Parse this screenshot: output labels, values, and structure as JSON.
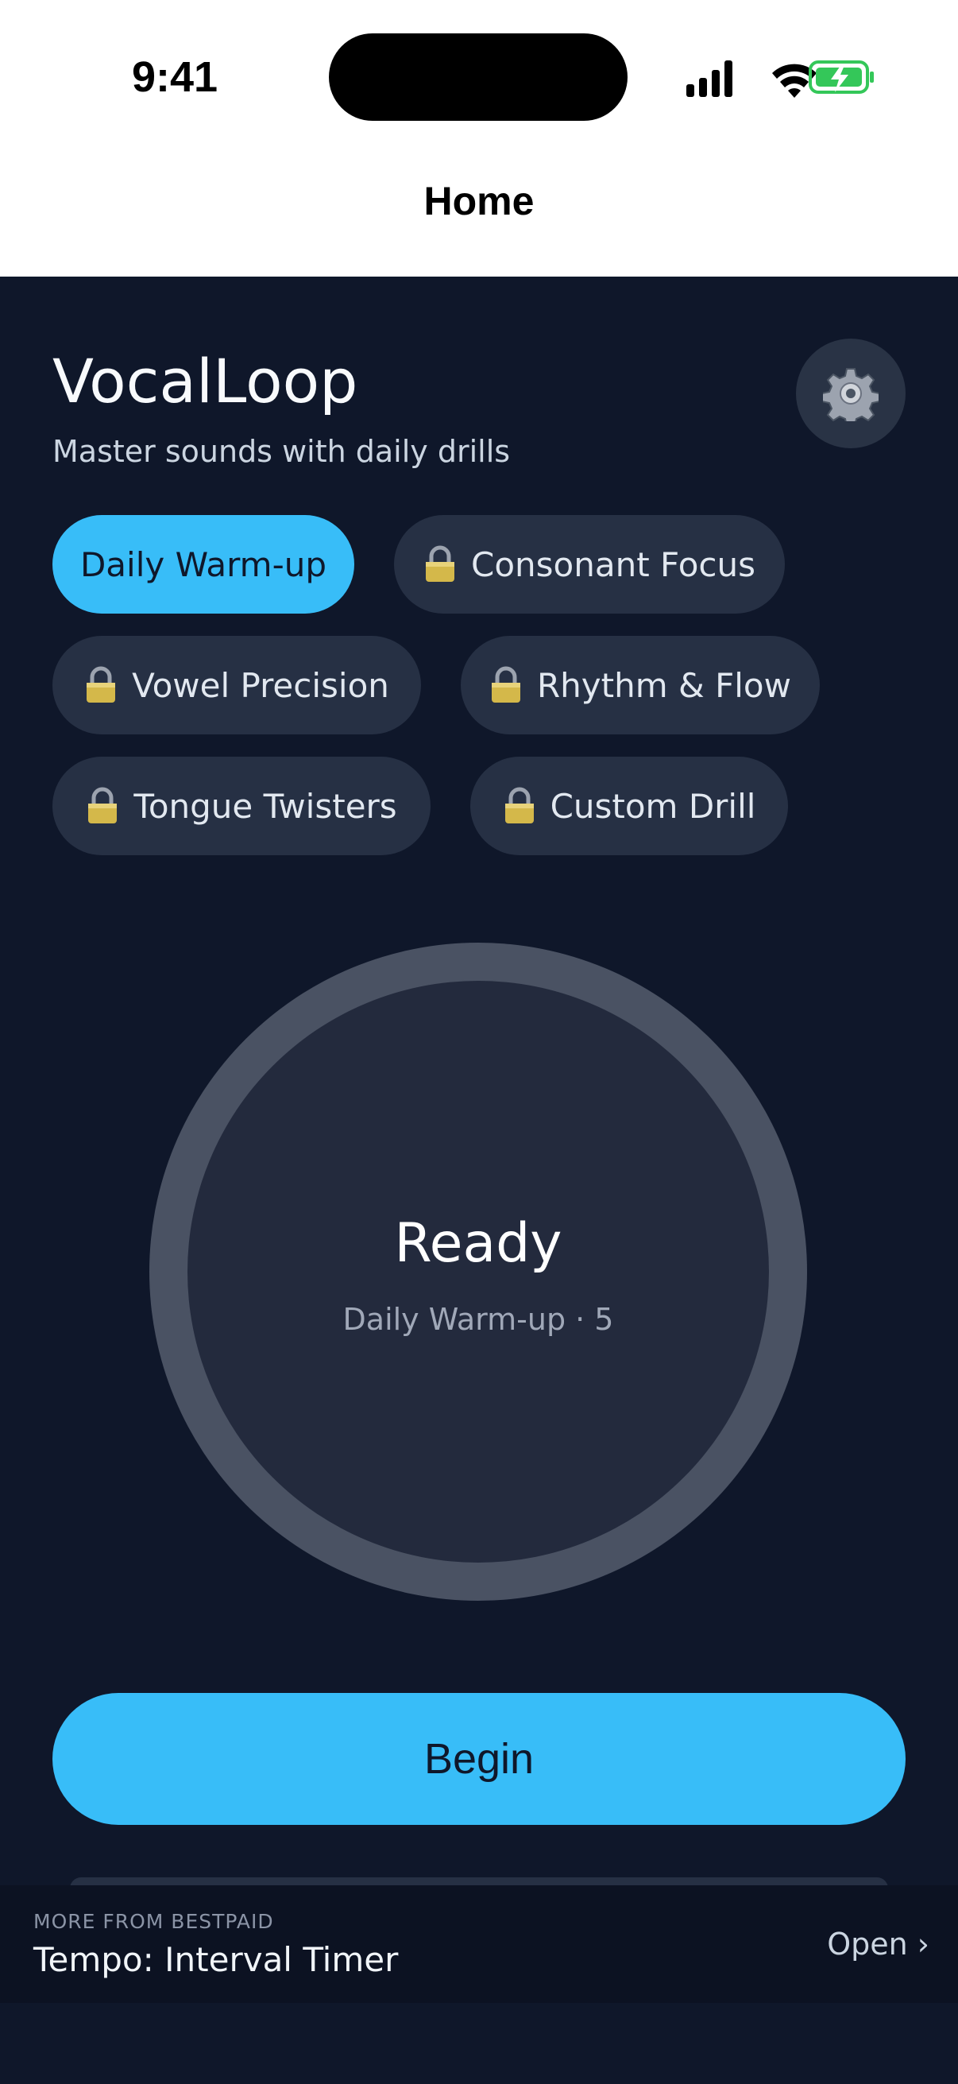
{
  "status_bar": {
    "time": "9:41",
    "icons": [
      "signal-icon",
      "wifi-icon",
      "battery-charging-icon"
    ],
    "battery_color": "#34c759"
  },
  "nav": {
    "title": "Home"
  },
  "header": {
    "title": "VocalLoop",
    "subtitle": "Master sounds with daily drills",
    "settings_icon": "gear-icon"
  },
  "drills": [
    {
      "label": "Daily Warm-up",
      "locked": false,
      "selected": true
    },
    {
      "label": "Consonant Focus",
      "locked": true,
      "selected": false
    },
    {
      "label": "Vowel Precision",
      "locked": true,
      "selected": false
    },
    {
      "label": "Rhythm & Flow",
      "locked": true,
      "selected": false
    },
    {
      "label": "Tongue Twisters",
      "locked": true,
      "selected": false
    },
    {
      "label": "Custom Drill",
      "locked": true,
      "selected": false
    }
  ],
  "dial": {
    "title": "Ready",
    "subtitle": "Daily Warm-up · 5"
  },
  "begin": {
    "label": "Begin"
  },
  "promo": {
    "eyebrow": "MORE FROM BESTPAID",
    "title": "Tempo: Interval Timer",
    "action": "Open ›"
  },
  "colors": {
    "background": "#0f172a",
    "accent": "#38bdf8",
    "chip": "#263044"
  }
}
